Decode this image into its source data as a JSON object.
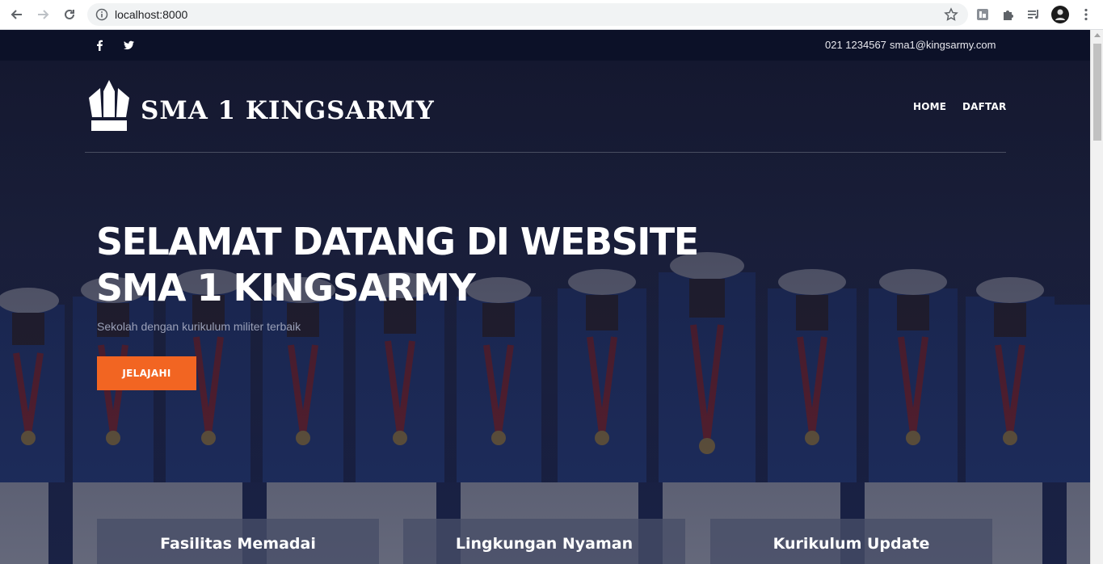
{
  "browser": {
    "url": "localhost:8000",
    "icons": [
      "back-arrow-icon",
      "forward-arrow-icon",
      "reload-icon",
      "info-icon",
      "bookmark-star-icon",
      "extension-icon",
      "puzzle-icon",
      "media-queue-icon",
      "profile-avatar",
      "menu-kebab-icon"
    ]
  },
  "topbar": {
    "phone": "021 1234567",
    "email": "sma1@kingsarmy.com",
    "socials": [
      "facebook-icon",
      "twitter-icon"
    ]
  },
  "header": {
    "brand_name": "SMA 1 KINGSARMY",
    "menu": [
      {
        "label": "HOME"
      },
      {
        "label": "DAFTAR"
      }
    ]
  },
  "hero": {
    "title_line1": "SELAMAT DATANG DI WEBSITE",
    "title_line2": "SMA 1 KINGSARMY",
    "subtitle": "Sekolah dengan kurikulum militer terbaik",
    "cta_label": "JELAJAHI"
  },
  "features": [
    {
      "title": "Fasilitas Memadai"
    },
    {
      "title": "Lingkungan Nyaman"
    },
    {
      "title": "Kurikulum Update"
    }
  ],
  "colors": {
    "accent": "#f26522",
    "topbar_bg": "#0c1128",
    "hero_overlay": "#121630"
  }
}
